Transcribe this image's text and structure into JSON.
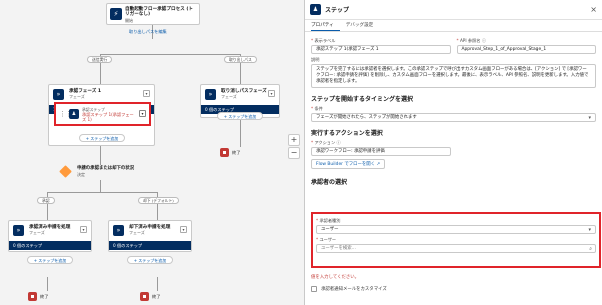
{
  "canvas": {
    "start_node": {
      "title": "自動起動フロー承認プロセス (トリガーなし)",
      "subtitle": "開始",
      "link": "取り出しパスを編集"
    },
    "path_labels": {
      "submit": "送信実行",
      "recall": "取り出しパス",
      "approve": "承認",
      "reject": "却下 (デフォルト)"
    },
    "stage1": {
      "title": "承認フェーズ 1",
      "subtitle": "フェーズ",
      "bar": "1 個のステップ",
      "add": "+ ステップを追加"
    },
    "step": {
      "label": "承認ステップ",
      "title": "承認ステップ 1(承認フェーズ 1)"
    },
    "recall_stage": {
      "title": "取り消しパスフェーズ",
      "subtitle": "フェーズ",
      "bar": "0 個のステップ",
      "add": "+ ステップを追加"
    },
    "decision": {
      "title": "申請の承認または却下の状況",
      "subtitle": "決定"
    },
    "approve_stage": {
      "title": "承認済み申請を処理",
      "subtitle": "フェーズ",
      "bar": "0 個のステップ",
      "add": "+ ステップを追加"
    },
    "reject_stage": {
      "title": "却下済み申請を処理",
      "subtitle": "フェーズ",
      "bar": "0 個のステップ",
      "add": "+ ステップを追加"
    },
    "end_label": "終了",
    "zoom_in": "+",
    "zoom_out": "−"
  },
  "panel": {
    "title": "ステップ",
    "close": "×",
    "tabs": [
      "プロパティ",
      "デバッグ設定"
    ],
    "label_field": {
      "label": "表示ラベル",
      "value": "承認ステップ 1(承認フェーズ 1"
    },
    "api_field": {
      "label": "API 参照名",
      "value": "Approval_Step_1_of_Approval_Stage_1"
    },
    "description": {
      "label": "説明",
      "value": "ステップを完了するには承認者を選択します。この承認ステップで呼び出すカスタム画面フローがある場合は、[アクション] で [承認ワークフロー: 承認申請を評価] を削除し、カスタム画面フローを選択します。最後に、表示ラベル、API 参照名、説明を更新します。入力値で承認者を指定します。"
    },
    "timing_section": "ステップを開始するタイミングを選択",
    "condition": {
      "label": "条件",
      "value": "フェーズが開始されたら、ステップが開始されます"
    },
    "action_section": "実行するアクションを選択",
    "action": {
      "label": "アクション",
      "value": "承認ワークフロー: 承認申請を評価",
      "button": "Flow Builder でフローを開く"
    },
    "approver_section": "承認者の選択",
    "approver_type": {
      "label": "承認者種別",
      "value": "ユーザー"
    },
    "user": {
      "label": "ユーザー",
      "placeholder": "ユーザーを検索..."
    },
    "error": "値を入力してください。",
    "email_checkbox": "承認者通知メールをカスタマイズ"
  }
}
